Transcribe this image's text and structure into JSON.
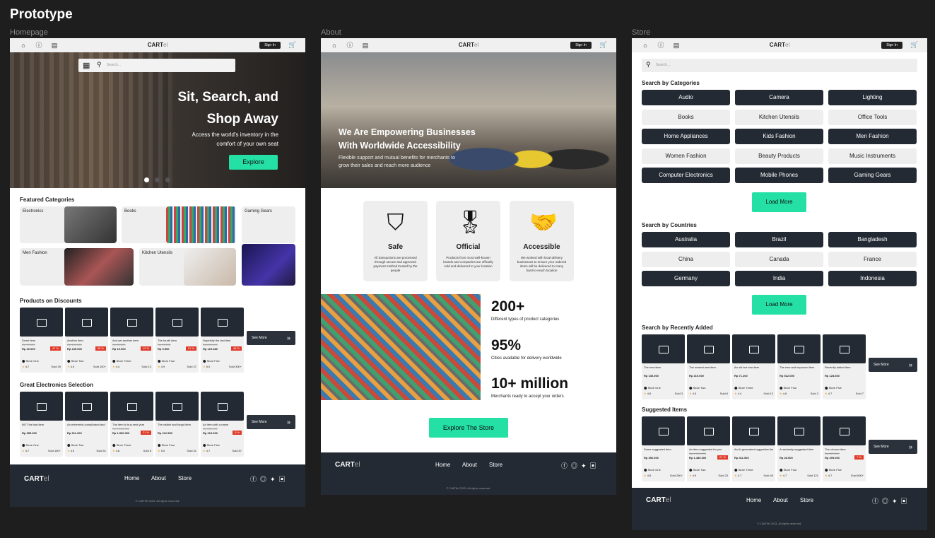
{
  "page_title": "Prototype",
  "frames": {
    "home": "Homepage",
    "about": "About",
    "store": "Store"
  },
  "nav": {
    "brand_bold": "CART",
    "brand_rest": "el",
    "signin": "Sign In"
  },
  "home": {
    "search_placeholder": "Search...",
    "hero_title1": "Sit, Search, and",
    "hero_title2": "Shop Away",
    "hero_sub1": "Access the world's inventory in the",
    "hero_sub2": "comfort of your own seat",
    "hero_btn": "Explore",
    "featured_title": "Featured Categories",
    "featured": [
      "Electronics",
      "Books",
      "Gaming Gears",
      "Men Fashion",
      "Kitchen Utensils"
    ],
    "discount_title": "Products on Discounts",
    "discounts": [
      {
        "name": "Some item",
        "old": "Rp 70.000",
        "price": "Rp 40.000",
        "disc": "47 %",
        "store": "Store One",
        "rating": "4.7",
        "sold": "Sold 39"
      },
      {
        "name": "Another item",
        "old": "Rp 409.000",
        "price": "Rp 249.000",
        "disc": "55 %",
        "store": "Store Two",
        "rating": "4.9",
        "sold": "Sold 100+"
      },
      {
        "name": "And yet another item",
        "old": "Rp 25.000",
        "price": "Rp 19.000",
        "disc": "12 %",
        "store": "Store Three",
        "rating": "4.4",
        "sold": "Sold 13"
      },
      {
        "name": "The fourth item",
        "old": "Rp 12.000",
        "price": "Rp 9.500",
        "disc": "21 %",
        "store": "Store Four",
        "rating": "4.9",
        "sold": "Sold 37"
      },
      {
        "name": "Hopefully the last item",
        "old": "Rp 249.000",
        "price": "Rp 129.480",
        "disc": "48 %",
        "store": "Store Five",
        "rating": "5.0",
        "sold": "Sold 300+"
      }
    ],
    "electronics_title": "Great Electronics Selection",
    "electronics": [
      {
        "name": "NOT the last item",
        "old": "",
        "price": "Rp 355.000",
        "disc": "",
        "store": "Store One",
        "rating": "4.7",
        "sold": "Sold 150+"
      },
      {
        "name": "An extremely complicated and long-named item",
        "old": "",
        "price": "Rp 311.200",
        "disc": "",
        "store": "Store Two",
        "rating": "4.9",
        "sold": "Sold 51"
      },
      {
        "name": "The item to buy next year",
        "old": "Rp 2.000.000",
        "price": "Rp 1.590.000",
        "disc": "21 %",
        "store": "Store Three",
        "rating": "4.8",
        "sold": "Sold 8"
      },
      {
        "name": "The visible and forgot item",
        "old": "",
        "price": "Rp 212.500",
        "disc": "",
        "store": "Store Four",
        "rating": "5.0",
        "sold": "Sold 41"
      },
      {
        "name": "An item with a name",
        "old": "Rp 230.000",
        "price": "Rp 219.000",
        "disc": "5 %",
        "store": "Store Five",
        "rating": "4.7",
        "sold": "Sold 87"
      }
    ],
    "see_more": "See More"
  },
  "about": {
    "hero_title1": "We Are Empowering Businesses",
    "hero_title2": "With Worldwide Accessibility",
    "hero_sub1": "Flexible support and mutual benefits for merchants to",
    "hero_sub2": "grow their sales and reach more audience",
    "features": [
      {
        "title": "Safe",
        "desc": "All transactions are processed through secure and approved payment method trusted by the people",
        "icon": "shield-lock-icon"
      },
      {
        "title": "Official",
        "desc": "Products from most well-known brands and companies are officially sold and delivered to your location",
        "icon": "award-ribbon-icon"
      },
      {
        "title": "Accessible",
        "desc": "We worked with local delivery businesses to ensure your ordered items will be delivered to many hard-to-reach location",
        "icon": "handshake-icon"
      }
    ],
    "stats": [
      {
        "value": "200+",
        "label": "Different types of product categories"
      },
      {
        "value": "95%",
        "label": "Cities available for delivery worldwide"
      },
      {
        "value": "10+ million",
        "label": "Merchants ready to accept your orders"
      }
    ],
    "cta": "Explore The Store"
  },
  "store": {
    "search_placeholder": "Search...",
    "cat_title": "Search by Categories",
    "categories": [
      "Audio",
      "Camera",
      "Lighting",
      "Books",
      "Kitchen Utensils",
      "Office Tools",
      "Home Appliances",
      "Kids Fashion",
      "Men Fashion",
      "Women Fashion",
      "Beauty Products",
      "Music Instruments",
      "Computer Electronics",
      "Mobile Phones",
      "Gaming Gears"
    ],
    "load_more": "Load More",
    "country_title": "Search by Countries",
    "countries": [
      "Australia",
      "Brazil",
      "Bangladesh",
      "China",
      "Canada",
      "France",
      "Germany",
      "India",
      "Indonesia"
    ],
    "recent_title": "Search by Recently Added",
    "recent": [
      {
        "name": "The new item",
        "old": "",
        "price": "Rp 135.000",
        "disc": "",
        "store": "Store One",
        "rating": "4.8",
        "sold": "Sold 3"
      },
      {
        "name": "The newest new item",
        "old": "",
        "price": "Rp 219.000",
        "disc": "",
        "store": "Store Two",
        "rating": "4.9",
        "sold": "Sold 8"
      },
      {
        "name": "An old but new item",
        "old": "",
        "price": "Rp 71.200",
        "disc": "",
        "store": "Store Three",
        "rating": "4.4",
        "sold": "Sold 13"
      },
      {
        "name": "The new and improved item",
        "old": "",
        "price": "Rp 512.000",
        "disc": "",
        "store": "Store Four",
        "rating": "4.6",
        "sold": "Sold 2"
      },
      {
        "name": "Recently added item",
        "old": "",
        "price": "Rp 128.600",
        "disc": "",
        "store": "Store Five",
        "rating": "4.7",
        "sold": "Sold 7"
      }
    ],
    "suggest_title": "Suggested Items",
    "suggested": [
      {
        "name": "Some suggested item",
        "old": "",
        "price": "Rp 350.000",
        "disc": "",
        "store": "Store One",
        "rating": "4.8",
        "sold": "Sold 250+"
      },
      {
        "name": "An item suggested for you",
        "old": "Rp 1.900.000",
        "price": "Rp 1.485.000",
        "disc": "21 %",
        "store": "Store Two",
        "rating": "4.9",
        "sold": "Sold 23"
      },
      {
        "name": "An AI generated suggestive item",
        "old": "",
        "price": "Rp 311.500",
        "disc": "",
        "store": "Store Three",
        "rating": "4.7",
        "sold": "Sold 45"
      },
      {
        "name": "A randomly suggested item",
        "old": "",
        "price": "Rp 28.900",
        "disc": "",
        "store": "Store Four",
        "rating": "4.7",
        "sold": "Sold 121"
      },
      {
        "name": "The chosen item",
        "old": "Rp 329.000",
        "price": "Rp 299.000",
        "disc": "7 %",
        "store": "Store Five",
        "rating": "4.7",
        "sold": "Sold 600+"
      }
    ],
    "see_more": "See More"
  },
  "footer": {
    "links": [
      "Home",
      "About",
      "Store"
    ],
    "copy": "© CARTel 2023. All rights reserved."
  },
  "colors": {
    "accent": "#25e0a4",
    "dark": "#232a33",
    "discount": "#e03a2a"
  }
}
